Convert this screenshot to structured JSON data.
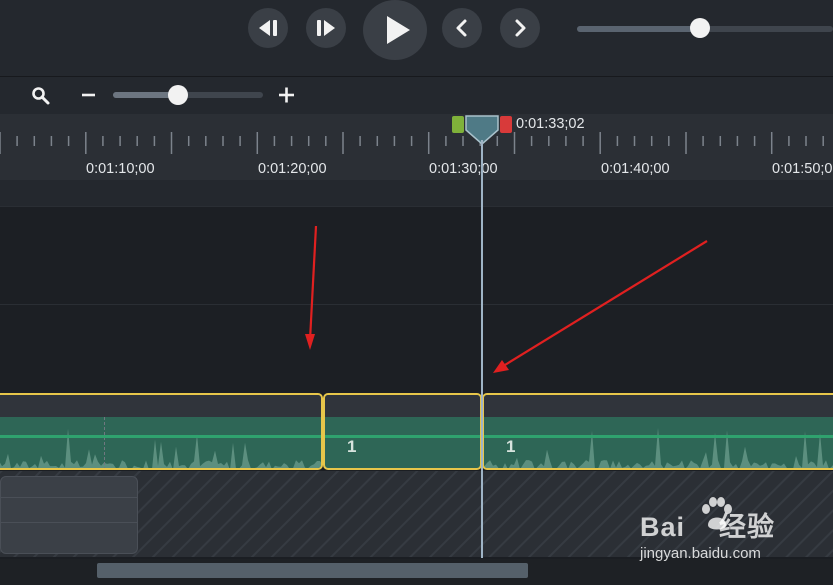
{
  "ruler": {
    "tick_labels": [
      "0:01:10;00",
      "0:01:20;00",
      "0:01:30;00",
      "0:01:40;00",
      "0:01:50;0"
    ],
    "playhead_time": "0:01:33;02"
  },
  "clips": [
    {
      "label": ""
    },
    {
      "label": "1"
    },
    {
      "label": "1"
    }
  ],
  "watermark": {
    "brand": "Bai",
    "brand_suffix": "经验",
    "url": "jingyan.baidu.com"
  },
  "colors": {
    "panel": "#24282e",
    "ruler": "#2b2f35",
    "clip_border": "#e7c64a",
    "audio_fill": "#2e6656",
    "audio_line": "#2fa26e",
    "playhead": "#9fb4c6",
    "annotation_arrow": "#e02020",
    "in_marker": "#7fb13a",
    "out_marker": "#d83a3a"
  },
  "icons": {
    "prev_frame": "step-back-icon",
    "next_frame": "step-forward-icon",
    "play": "play-icon",
    "prev_marker": "chevron-left-icon",
    "next_marker": "chevron-right-icon",
    "zoom": "magnifier-icon",
    "zoom_out": "minus-icon",
    "zoom_in": "plus-icon"
  },
  "controls": {
    "volume_level": 0.48,
    "zoom_level": 0.44,
    "scroll_position": 0.12
  }
}
